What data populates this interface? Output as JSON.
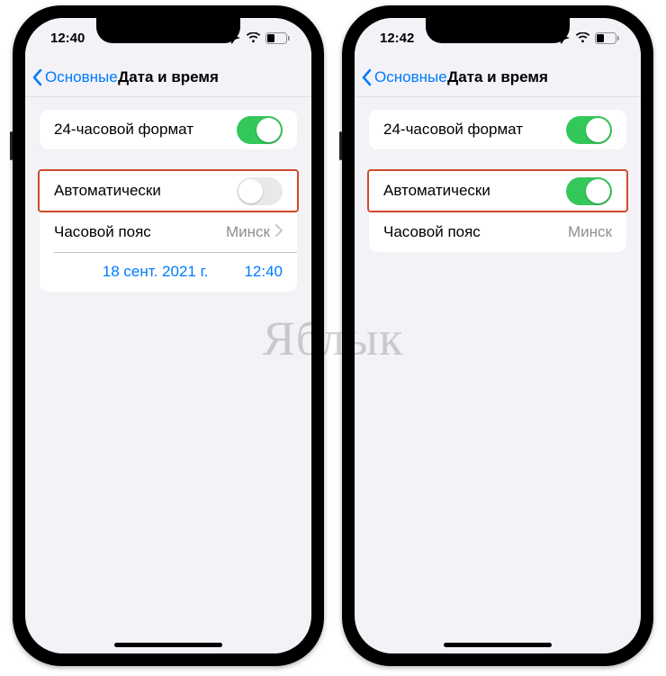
{
  "watermark": "Яблык",
  "phones": [
    {
      "status": {
        "time": "12:40"
      },
      "nav": {
        "back": "Основные",
        "title": "Дата и время"
      },
      "rows": {
        "format24_label": "24-часовой формат",
        "format24_on": true,
        "auto_label": "Автоматически",
        "auto_on": false,
        "timezone_label": "Часовой пояс",
        "timezone_value": "Минск",
        "timezone_disclosure": true,
        "date_value": "18 сент. 2021 г.",
        "time_value": "12:40",
        "show_datetime_row": true
      }
    },
    {
      "status": {
        "time": "12:42"
      },
      "nav": {
        "back": "Основные",
        "title": "Дата и время"
      },
      "rows": {
        "format24_label": "24-часовой формат",
        "format24_on": true,
        "auto_label": "Автоматически",
        "auto_on": true,
        "timezone_label": "Часовой пояс",
        "timezone_value": "Минск",
        "timezone_disclosure": false,
        "date_value": "",
        "time_value": "",
        "show_datetime_row": false
      }
    }
  ]
}
